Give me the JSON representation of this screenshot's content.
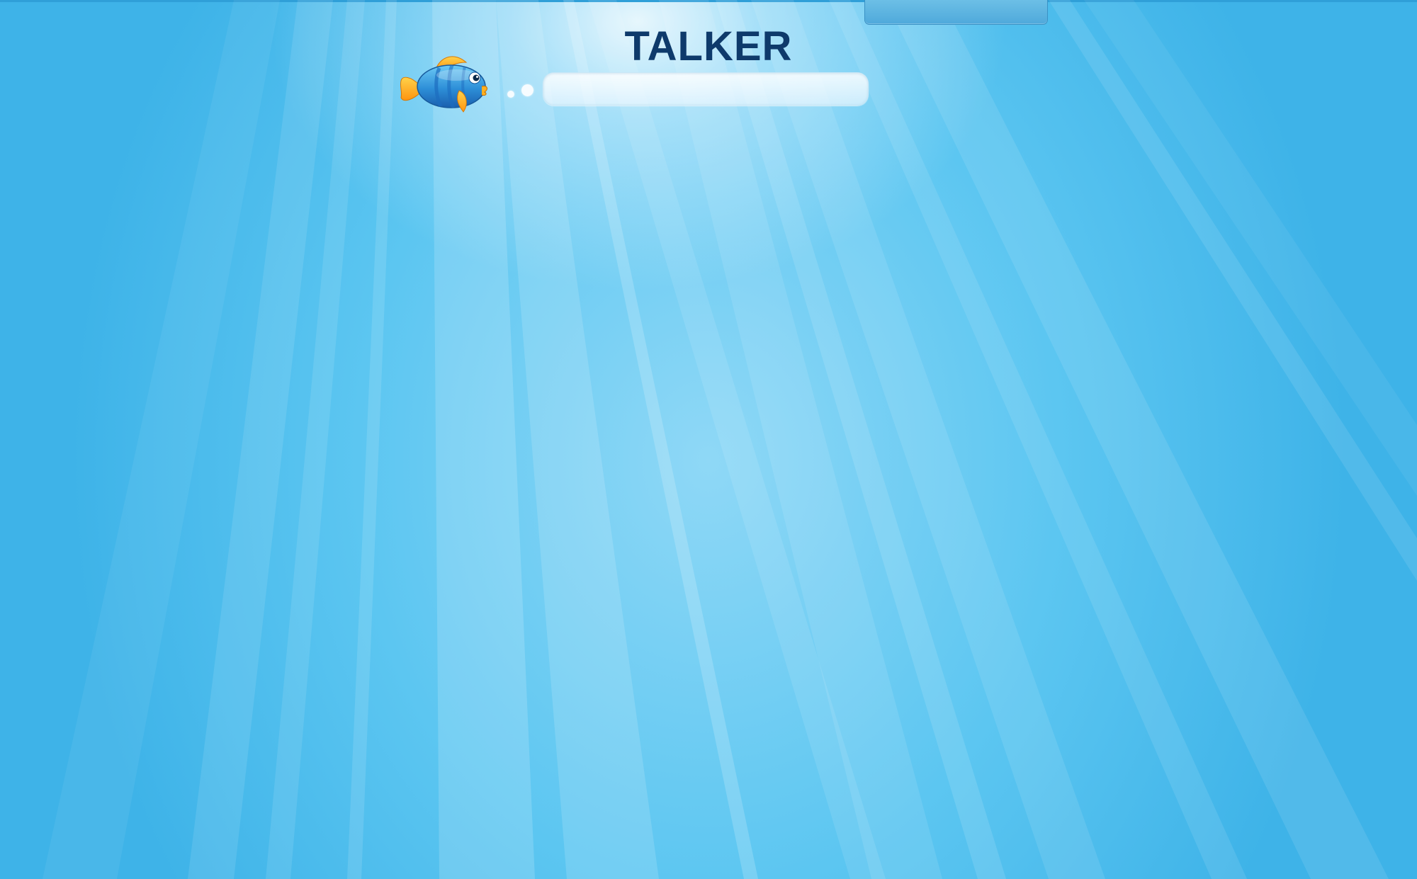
{
  "app": {
    "title": "TALKER"
  },
  "talk_input": {
    "value": "",
    "placeholder": ""
  },
  "icons": {
    "mascot": "fish-icon",
    "bubbles": "thought-bubbles-icon"
  },
  "colors": {
    "title": "#0e3a6b",
    "background_top": "#56c4ef",
    "background_light": "#dff3ff",
    "fish_body": "#2e8fd6",
    "fish_fins": "#ffab1a",
    "top_tab": "#5bb3e0"
  }
}
